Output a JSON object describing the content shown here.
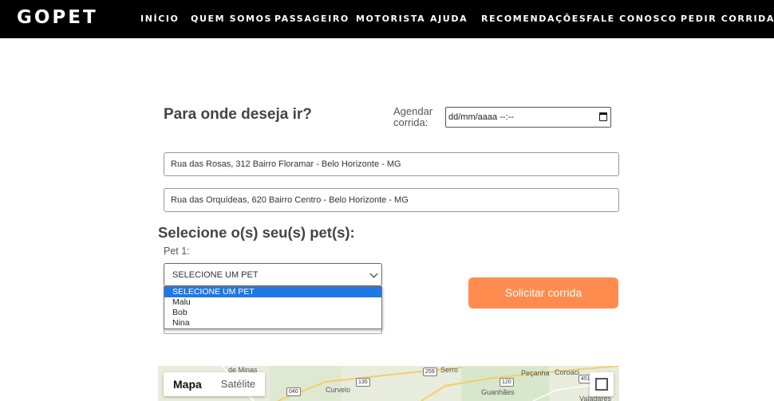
{
  "nav": {
    "brand": "GOPET",
    "items": [
      "INÍCIO",
      "QUEM SOMOS",
      "PASSAGEIRO",
      "MOTORISTA",
      "AJUDA",
      "RECOMENDAÇÕES",
      "FALE CONOSCO",
      "PEDIR CORRIDA"
    ]
  },
  "form": {
    "heading": "Para onde deseja ir?",
    "schedule_label": "Agendar corrida:",
    "schedule_value": "dd/mm/aaaa --:--",
    "origin": "Rua das Rosas, 312 Bairro Floramar - Belo Horizonte - MG",
    "destination": "Rua das Orquídeas, 620 Bairro Centro - Belo Horizonte - MG",
    "pets_heading": "Selecione o(s) seu(s) pet(s):",
    "pet_label": "Pet 1:",
    "pet_selected": "SELECIONE UM PET",
    "pet_options": [
      "SELECIONE UM PET",
      "Malu",
      "Bob",
      "Nina"
    ],
    "request_button": "Solicitar corrida"
  },
  "map": {
    "tabs": [
      "Mapa",
      "Satélite"
    ],
    "active_tab": "Mapa",
    "labels": [
      "Curvelo",
      "Serro",
      "Peçanha",
      "Coroaci",
      "Guanhães",
      "Valadares",
      "de Minas"
    ],
    "road_signs": [
      "040",
      "135",
      "259",
      "120",
      "451"
    ]
  },
  "colors": {
    "navbar": "#000000",
    "request_button": "#ff8c4e",
    "dropdown_highlight": "#1e78e6"
  }
}
